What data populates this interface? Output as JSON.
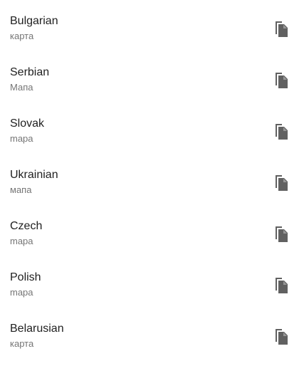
{
  "translations": [
    {
      "language": "Bulgarian",
      "word": "карта"
    },
    {
      "language": "Serbian",
      "word": "Мапа"
    },
    {
      "language": "Slovak",
      "word": "mapa"
    },
    {
      "language": "Ukrainian",
      "word": "мапа"
    },
    {
      "language": "Czech",
      "word": "mapa"
    },
    {
      "language": "Polish",
      "word": "mapa"
    },
    {
      "language": "Belarusian",
      "word": "карта"
    }
  ],
  "icon": "copy-icon",
  "colors": {
    "primary_text": "#212121",
    "secondary_text": "#757575",
    "icon": "#616161",
    "background": "#ffffff"
  }
}
